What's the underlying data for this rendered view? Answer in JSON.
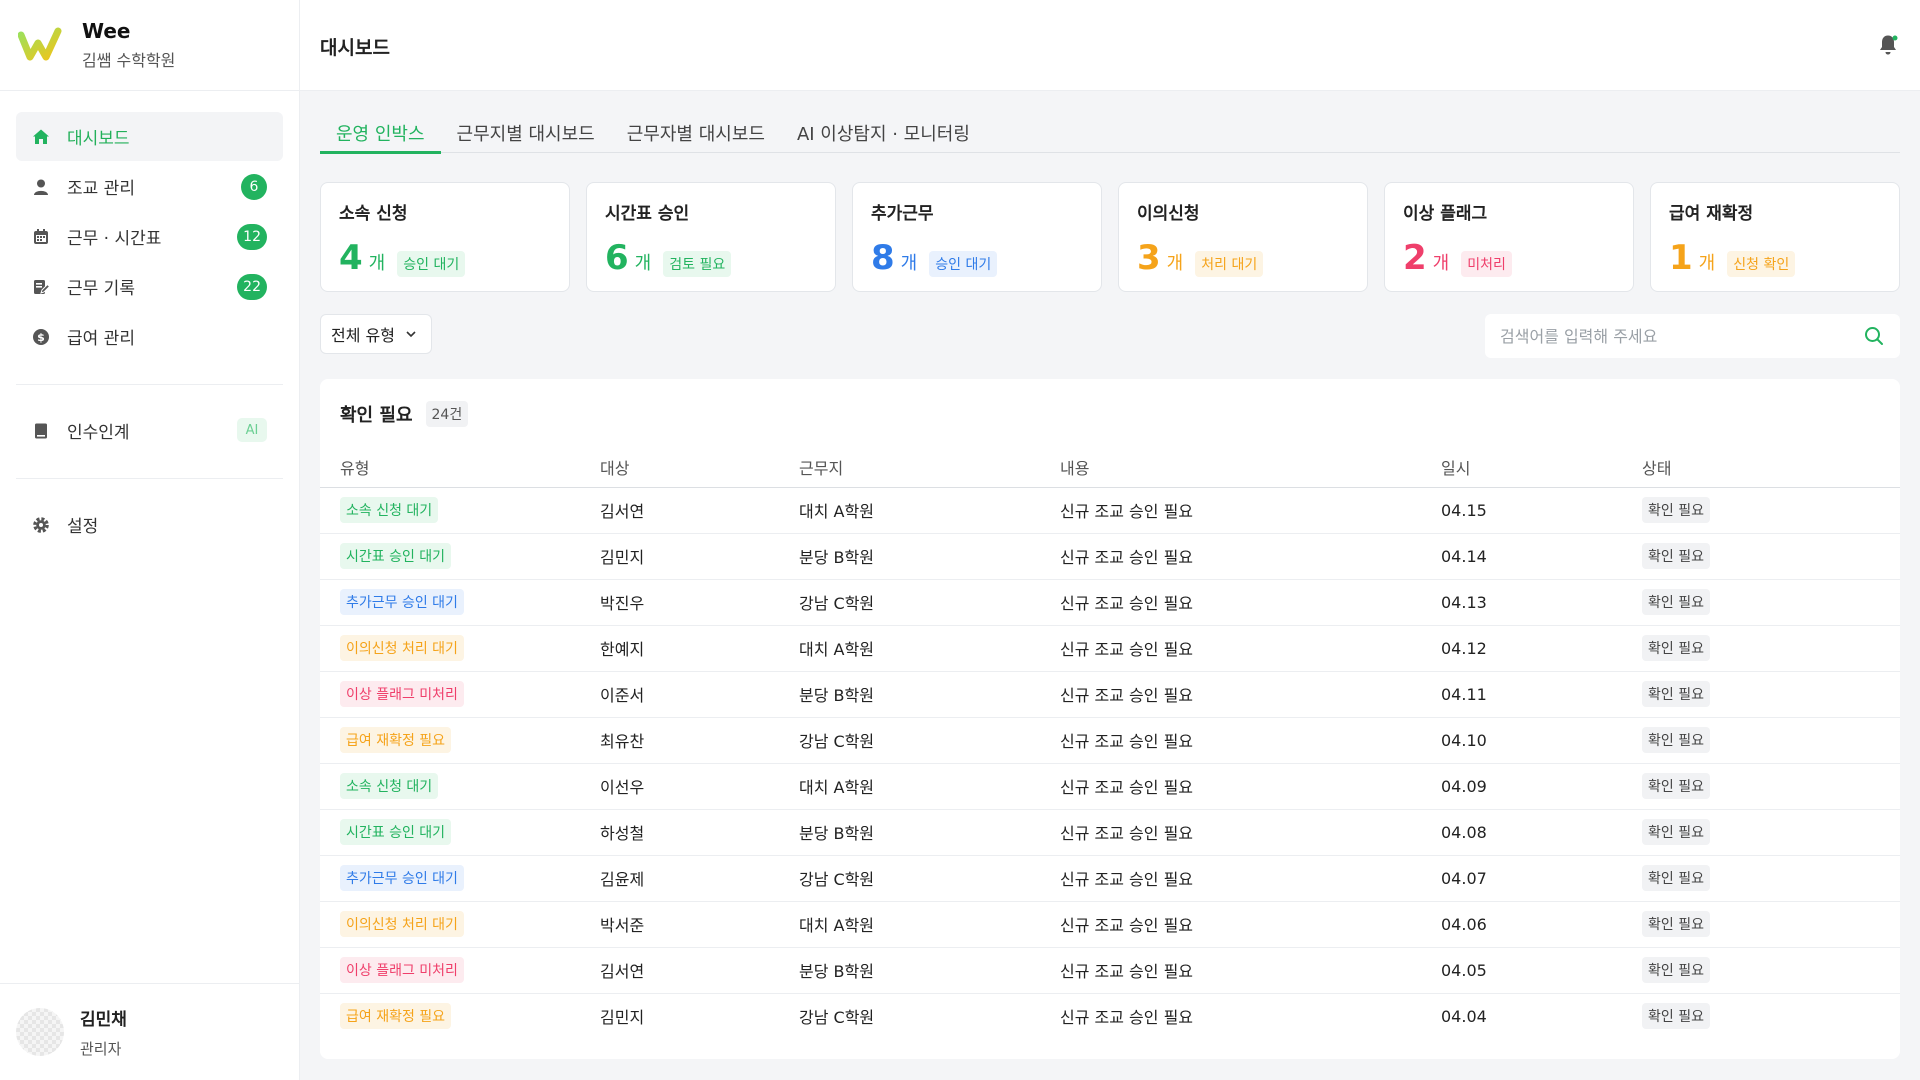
{
  "brand": {
    "name": "Wee",
    "sub": "김쌤 수학학원"
  },
  "sidebar": {
    "items": [
      {
        "label": "대시보드",
        "icon": "home-icon",
        "badge": ""
      },
      {
        "label": "조교 관리",
        "icon": "user-icon",
        "badge": "6"
      },
      {
        "label": "근무 · 시간표",
        "icon": "calendar-icon",
        "badge": "12"
      },
      {
        "label": "근무 기록",
        "icon": "edit-record-icon",
        "badge": "22"
      },
      {
        "label": "급여 관리",
        "icon": "dollar-icon",
        "badge": ""
      }
    ],
    "handover": {
      "label": "인수인계",
      "tag": "AI"
    },
    "settings": {
      "label": "설정"
    }
  },
  "user": {
    "name": "김민채",
    "role": "관리자"
  },
  "header": {
    "title": "대시보드"
  },
  "tabs": [
    "운영 인박스",
    "근무지별 대시보드",
    "근무자별 대시보드",
    "AI 이상탐지 · 모니터링"
  ],
  "cards": [
    {
      "title": "소속 신청",
      "value": "4",
      "unit": "개",
      "tag": "승인 대기",
      "color": "#22b35f"
    },
    {
      "title": "시간표 승인",
      "value": "6",
      "unit": "개",
      "tag": "검토 필요",
      "color": "#22b35f"
    },
    {
      "title": "추가근무",
      "value": "8",
      "unit": "개",
      "tag": "승인 대기",
      "color": "#2f7be8"
    },
    {
      "title": "이의신청",
      "value": "3",
      "unit": "개",
      "tag": "처리 대기",
      "color": "#f5a31a"
    },
    {
      "title": "이상 플래그",
      "value": "2",
      "unit": "개",
      "tag": "미처리",
      "color": "#ef3f6b"
    },
    {
      "title": "급여 재확정",
      "value": "1",
      "unit": "개",
      "tag": "신청 확인",
      "color": "#f5a31a"
    }
  ],
  "filter": {
    "label": "전체 유형"
  },
  "search": {
    "placeholder": "검색어를 입력해 주세요"
  },
  "panel": {
    "title": "확인 필요",
    "count": "24건",
    "columns": [
      "유형",
      "대상",
      "근무지",
      "내용",
      "일시",
      "상태"
    ],
    "rows": [
      {
        "type": "소속 신청 대기",
        "tone": "green",
        "target": "김서연",
        "place": "대치 A학원",
        "content": "신규 조교 승인 필요",
        "date": "04.15",
        "status": "확인 필요"
      },
      {
        "type": "시간표 승인 대기",
        "tone": "green",
        "target": "김민지",
        "place": "분당 B학원",
        "content": "신규 조교 승인 필요",
        "date": "04.14",
        "status": "확인 필요"
      },
      {
        "type": "추가근무 승인 대기",
        "tone": "blue",
        "target": "박진우",
        "place": "강남 C학원",
        "content": "신규 조교 승인 필요",
        "date": "04.13",
        "status": "확인 필요"
      },
      {
        "type": "이의신청 처리 대기",
        "tone": "orange",
        "target": "한예지",
        "place": "대치 A학원",
        "content": "신규 조교 승인 필요",
        "date": "04.12",
        "status": "확인 필요"
      },
      {
        "type": "이상 플래그 미처리",
        "tone": "red",
        "target": "이준서",
        "place": "분당 B학원",
        "content": "신규 조교 승인 필요",
        "date": "04.11",
        "status": "확인 필요"
      },
      {
        "type": "급여 재확정 필요",
        "tone": "orange",
        "target": "최유찬",
        "place": "강남 C학원",
        "content": "신규 조교 승인 필요",
        "date": "04.10",
        "status": "확인 필요"
      },
      {
        "type": "소속 신청 대기",
        "tone": "green",
        "target": "이선우",
        "place": "대치 A학원",
        "content": "신규 조교 승인 필요",
        "date": "04.09",
        "status": "확인 필요"
      },
      {
        "type": "시간표 승인 대기",
        "tone": "green",
        "target": "하성철",
        "place": "분당 B학원",
        "content": "신규 조교 승인 필요",
        "date": "04.08",
        "status": "확인 필요"
      },
      {
        "type": "추가근무 승인 대기",
        "tone": "blue",
        "target": "김윤제",
        "place": "강남 C학원",
        "content": "신규 조교 승인 필요",
        "date": "04.07",
        "status": "확인 필요"
      },
      {
        "type": "이의신청 처리 대기",
        "tone": "orange",
        "target": "박서준",
        "place": "대치 A학원",
        "content": "신규 조교 승인 필요",
        "date": "04.06",
        "status": "확인 필요"
      },
      {
        "type": "이상 플래그 미처리",
        "tone": "red",
        "target": "김서연",
        "place": "분당 B학원",
        "content": "신규 조교 승인 필요",
        "date": "04.05",
        "status": "확인 필요"
      },
      {
        "type": "급여 재확정 필요",
        "tone": "orange",
        "target": "김민지",
        "place": "강남 C학원",
        "content": "신규 조교 승인 필요",
        "date": "04.04",
        "status": "확인 필요"
      }
    ]
  },
  "colors": {
    "accent": "#22b35f",
    "blue": "#2f7be8",
    "orange": "#f5a31a",
    "red": "#ef3f6b"
  }
}
